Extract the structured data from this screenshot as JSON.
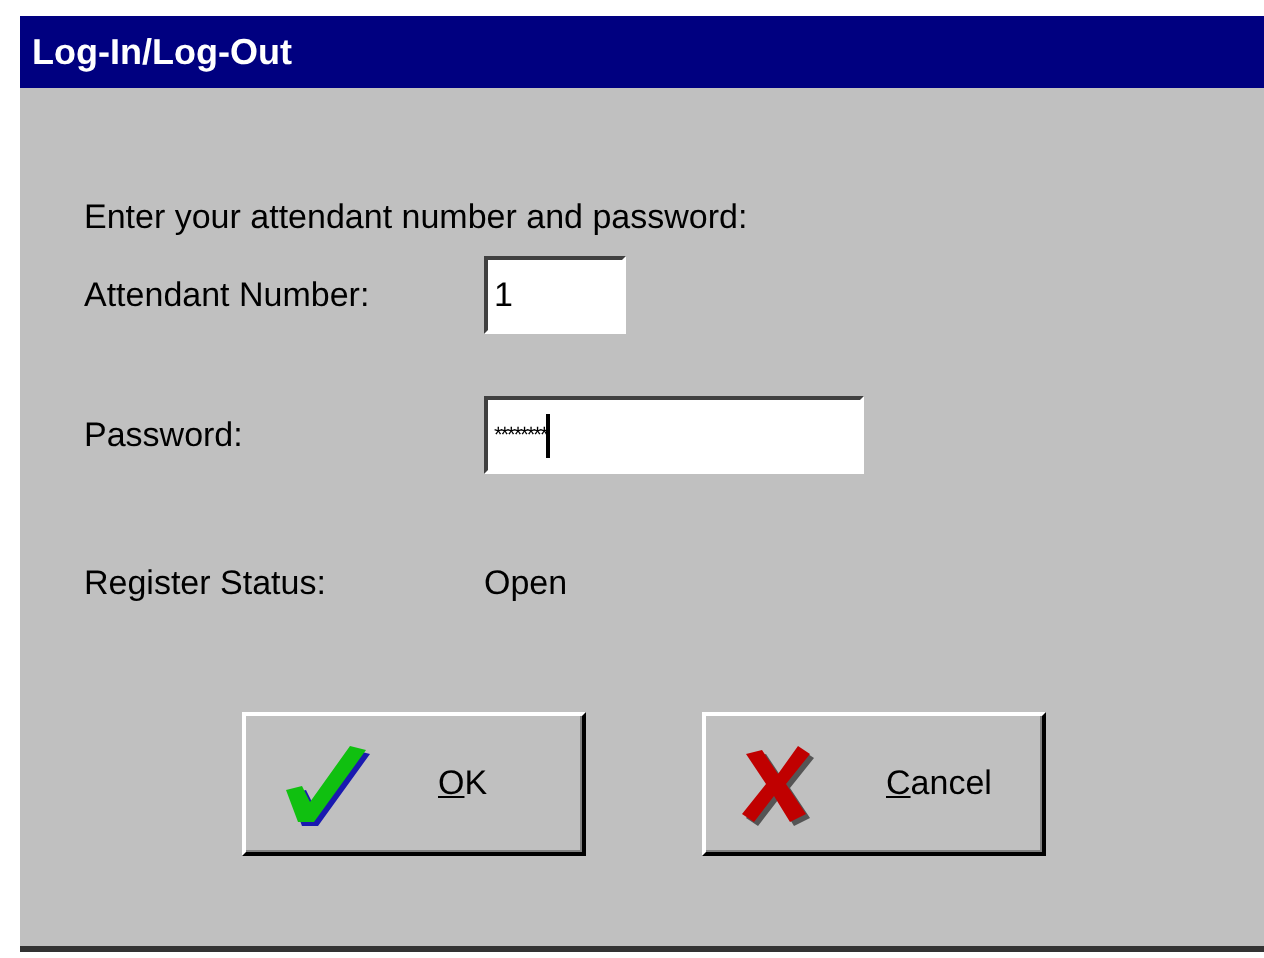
{
  "window": {
    "title": "Log-In/Log-Out"
  },
  "prompt": "Enter your attendant number and password:",
  "fields": [
    {
      "label": "Attendant Number:",
      "value": "1",
      "kind": "short",
      "focused": false
    },
    {
      "label": "Password:",
      "value": "********",
      "kind": "long",
      "focused": true
    }
  ],
  "status": {
    "label": "Register Status:",
    "value": "Open"
  },
  "buttons": [
    {
      "label": "OK",
      "kind": "ok"
    },
    {
      "label": "Cancel",
      "kind": "cancel"
    }
  ]
}
